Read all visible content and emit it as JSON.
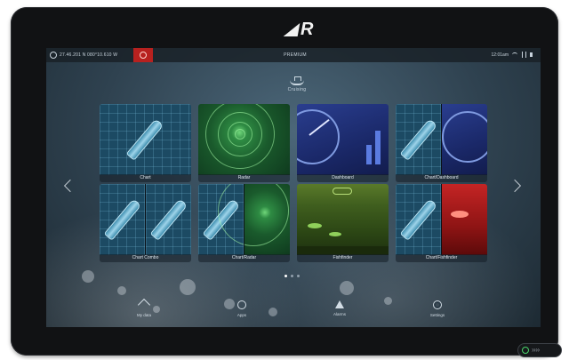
{
  "brand": {
    "logo_text": "R"
  },
  "statusbar": {
    "position_text": "27.46.201 N  080°10.610 W",
    "title": "PREMIUM",
    "clock": "12:01am"
  },
  "mode": {
    "label": "Cruising",
    "icon": "boat-icon"
  },
  "tiles": [
    {
      "label": "Chart",
      "icon": "chart-icon"
    },
    {
      "label": "Radar",
      "icon": "radar-icon"
    },
    {
      "label": "Dashboard",
      "icon": "dashboard-icon"
    },
    {
      "label": "Chart/Dashboard",
      "icon": "chart-dashboard-icon"
    },
    {
      "label": "Chart Combo",
      "icon": "chart-combo-icon"
    },
    {
      "label": "Chart/Radar",
      "icon": "chart-radar-icon"
    },
    {
      "label": "Fishfinder",
      "icon": "fishfinder-icon"
    },
    {
      "label": "Chart/Fishfinder",
      "icon": "chart-fishfinder-icon"
    }
  ],
  "pagination": {
    "current": 1,
    "total": 3
  },
  "bottom_nav": [
    {
      "label": "My data",
      "icon": "share-icon"
    },
    {
      "label": "Apps",
      "icon": "apps-icon"
    },
    {
      "label": "Alarms",
      "icon": "alarm-icon"
    },
    {
      "label": "Settings",
      "icon": "gear-icon"
    }
  ],
  "power": {
    "chevrons": "››››"
  },
  "colors": {
    "mob_red": "#b7211f",
    "power_green": "#49d36a",
    "bezel": "#111214"
  }
}
